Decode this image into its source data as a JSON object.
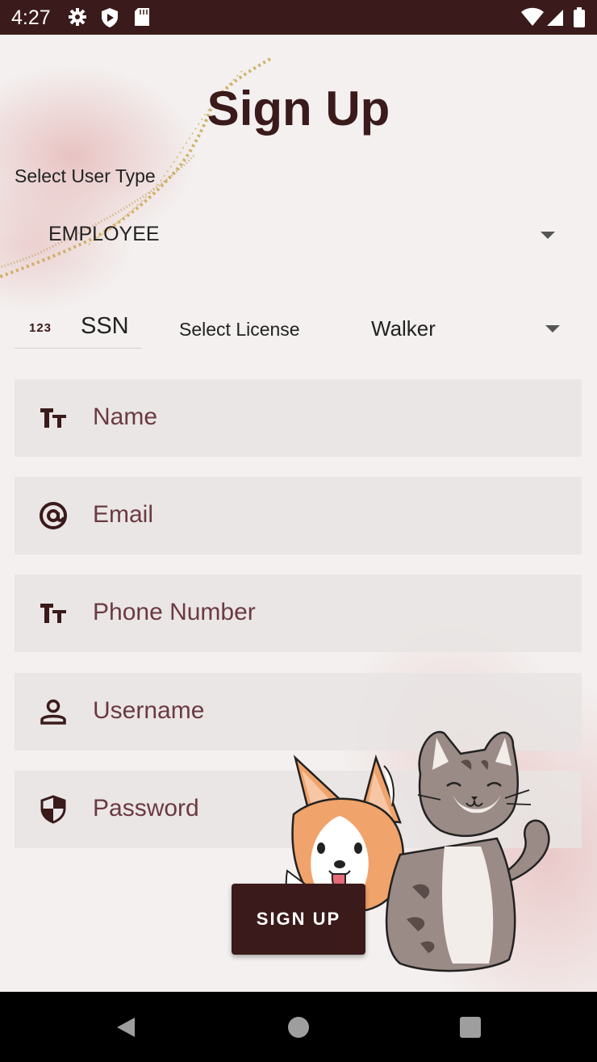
{
  "status_bar": {
    "time": "4:27",
    "left_icons": [
      "gear-icon",
      "shield-play-icon",
      "sd-card-icon"
    ],
    "right_icons": [
      "wifi-icon",
      "cellular-signal-icon",
      "battery-icon"
    ]
  },
  "page": {
    "title": "Sign Up",
    "user_type": {
      "label": "Select User Type",
      "selected": "EMPLOYEE"
    },
    "ssn": {
      "icon": "123",
      "label": "SSN"
    },
    "license": {
      "label": "Select License",
      "selected": "Walker"
    },
    "fields": [
      {
        "icon": "text-size-icon",
        "placeholder": "Name"
      },
      {
        "icon": "at-sign-icon",
        "placeholder": "Email"
      },
      {
        "icon": "text-size-icon",
        "placeholder": "Phone Number"
      },
      {
        "icon": "person-icon",
        "placeholder": "Username"
      },
      {
        "icon": "shield-icon",
        "placeholder": "Password"
      }
    ],
    "signup_button": "SIGN UP"
  },
  "colors": {
    "primary": "#3a1a1a",
    "placeholder": "#6b3a42",
    "accent_pink": "#e2aaaa",
    "gold": "#c9a24a"
  },
  "nav_bar": {
    "icons": [
      "back-icon",
      "home-icon",
      "recents-icon"
    ]
  }
}
